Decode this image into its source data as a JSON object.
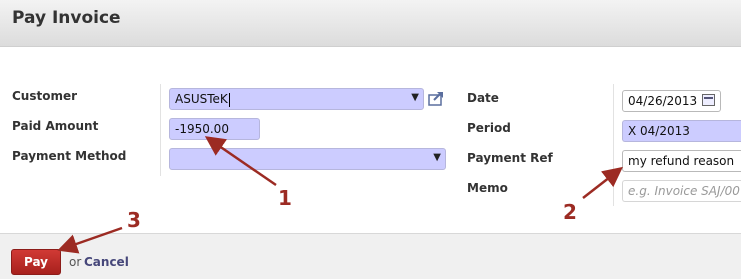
{
  "dialog": {
    "title": "Pay Invoice"
  },
  "left_form": {
    "customer_label": "Customer",
    "customer_value": "ASUSTeK",
    "paid_amount_label": "Paid Amount",
    "paid_amount_value": "-1950.00",
    "payment_method_label": "Payment Method",
    "payment_method_value": ""
  },
  "right_form": {
    "date_label": "Date",
    "date_value": "04/26/2013",
    "period_label": "Period",
    "period_value": "X 04/2013",
    "payment_ref_label": "Payment Ref",
    "payment_ref_value": "my refund reason",
    "memo_label": "Memo",
    "memo_placeholder": "e.g. Invoice SAJ/00"
  },
  "footer": {
    "pay_label": "Pay",
    "or_text": "or",
    "cancel_label": "Cancel"
  },
  "annotations": {
    "one": "1",
    "two": "2",
    "three": "3",
    "color": "#9c2b23"
  },
  "colors": {
    "required_field": "#ccccff",
    "pay_button": "#b82a26",
    "cancel_link": "#46477a"
  }
}
